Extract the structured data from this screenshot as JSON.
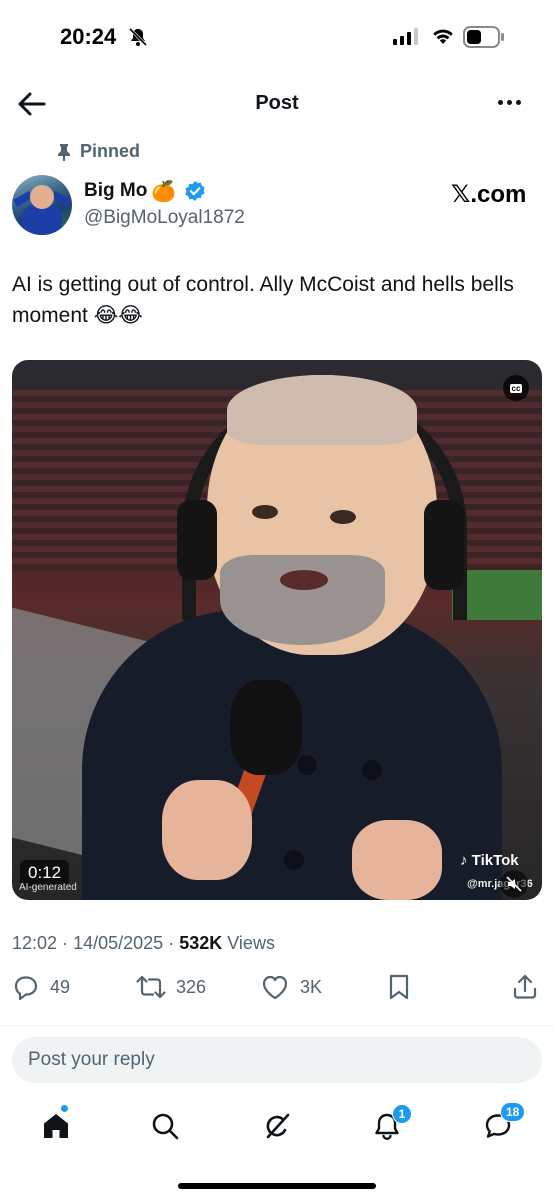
{
  "status_bar": {
    "time": "20:24",
    "icons": [
      "bell-slash-icon",
      "cellular-signal-icon",
      "wifi-icon",
      "battery-icon"
    ]
  },
  "header": {
    "title": "Post",
    "back_icon": "arrow-left-icon",
    "more_icon": "more-dots-icon"
  },
  "post": {
    "pinned_label": "Pinned",
    "author": {
      "display_name": "Big Mo",
      "name_emoji": "🍊",
      "verified": true,
      "handle": "@BigMoLoyal1872"
    },
    "source_label": "𝕏.com",
    "text": "AI is getting out of control. Ally McCoist and hells bells moment",
    "text_emoji": "😂😂",
    "video": {
      "duration": "0:12",
      "ai_label": "AI-generated",
      "watermark": "TikTok",
      "watermark_handle": "@mr.jager36",
      "cc_label": "cc"
    },
    "meta": {
      "time": "12:02",
      "separator": "·",
      "date": "14/05/2025",
      "views_count": "532K",
      "views_label": "Views"
    },
    "actions": {
      "replies": "49",
      "reposts": "326",
      "likes": "3K"
    }
  },
  "reply": {
    "placeholder": "Post your reply"
  },
  "bottom_nav": {
    "items": [
      "home-icon",
      "search-icon",
      "grok-icon",
      "notifications-icon",
      "messages-icon"
    ],
    "notifications_badge": "1",
    "messages_badge": "18"
  },
  "colors": {
    "accent": "#1d9bf0",
    "secondary_text": "#536471",
    "primary_text": "#0f1419"
  }
}
